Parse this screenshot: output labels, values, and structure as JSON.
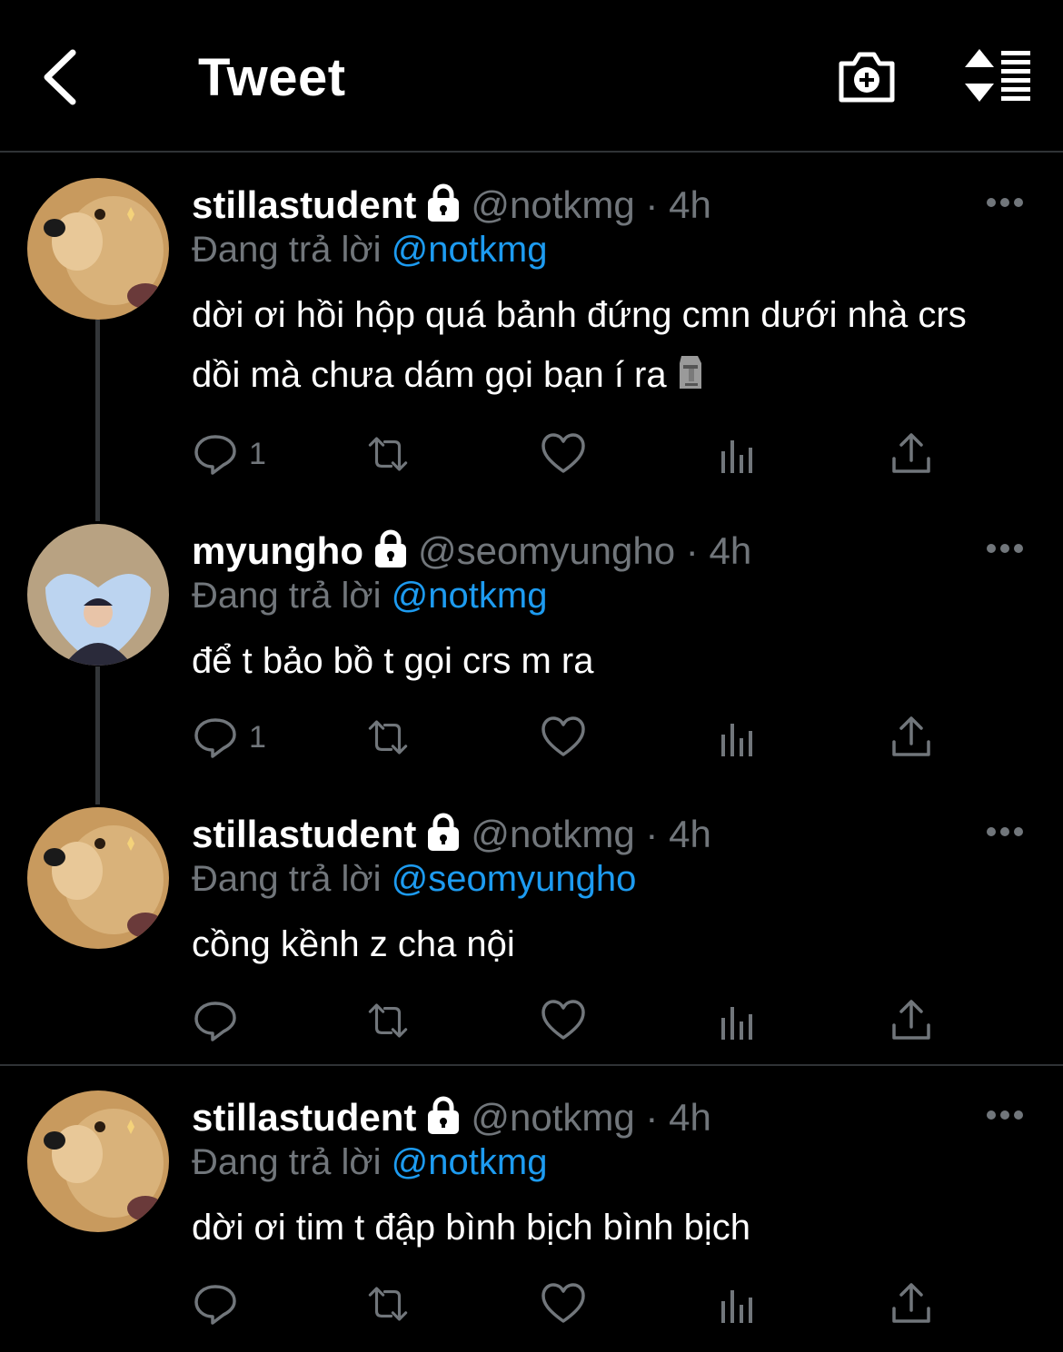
{
  "header": {
    "title": "Tweet",
    "back_icon": "chevron-left-icon",
    "camera_icon": "camera-plus-icon",
    "sort_icon": "sort-list-icon"
  },
  "tweets": [
    {
      "name": "stillastudent",
      "handle": "@notkmg",
      "dot": "·",
      "time": "4h",
      "reply_prefix": "Đang trả lời",
      "reply_to": "@notkmg",
      "text": "dời ơi hồi hộp quá bảnh đứng cmn dưới nhà crs dồi mà chưa dám gọi bạn í ra",
      "emoji": "moai",
      "reply_count": "1"
    },
    {
      "name": "myungho",
      "handle": "@seomyungho",
      "dot": "·",
      "time": "4h",
      "reply_prefix": "Đang trả lời",
      "reply_to": "@notkmg",
      "text": "để t bảo bồ t gọi crs m ra",
      "reply_count": "1"
    },
    {
      "name": "stillastudent",
      "handle": "@notkmg",
      "dot": "·",
      "time": "4h",
      "reply_prefix": "Đang trả lời",
      "reply_to": "@seomyungho",
      "text": "cồng kềnh z cha nội",
      "reply_count": ""
    },
    {
      "name": "stillastudent",
      "handle": "@notkmg",
      "dot": "·",
      "time": "4h",
      "reply_prefix": "Đang trả lời",
      "reply_to": "@notkmg",
      "text": "dời ơi tim t đập bình bịch bình bịch",
      "reply_count": ""
    }
  ],
  "colors": {
    "background": "#000000",
    "accent": "#1d9bf0",
    "muted": "#71767b",
    "divider": "#2f3336"
  }
}
